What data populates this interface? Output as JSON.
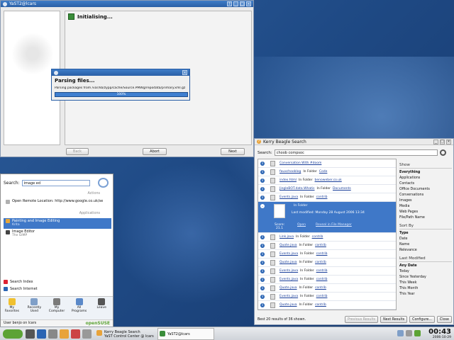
{
  "yast": {
    "title": "YaST2@lcars",
    "heading": "Initialising...",
    "buttons": {
      "back": "Back",
      "abort": "Abort",
      "next": "Next"
    }
  },
  "parsing": {
    "title": "",
    "heading": "Parsing files...",
    "detail": "Parsing packages from /var/lib/zypp/cache/Source.PMWg/repodata/primary.xml.gz",
    "progress_label": "100%",
    "progress": 100
  },
  "beagle": {
    "title": "Kerry Beagle Search",
    "search_label": "Search:",
    "search_value": "choob compsoc",
    "results": [
      {
        "name": "Conversation With #doom",
        "mid": "",
        "folder": ""
      },
      {
        "name": "fauxchooblog",
        "mid": "In Folder",
        "folder": "Code"
      },
      {
        "name": "index.html",
        "mid": "In Folder",
        "folder": "benoweber.co.uk"
      },
      {
        "name": "JingleBOT.data.Whatis",
        "mid": "In Folder",
        "folder": "Documents"
      },
      {
        "name": "Events.java",
        "mid": "In Folder",
        "folder": "contrib"
      }
    ],
    "selected": {
      "name": "",
      "mid": "In Folder",
      "folder": "",
      "modified": "Last modified: Monday 28 August 2006 13:34",
      "score_label": "Score:",
      "score": "21.1",
      "action_open": "Open",
      "action_reveal": "Reveal in File Manager"
    },
    "results_after": [
      {
        "name": "Link.java",
        "mid": "In Folder",
        "folder": "contrib"
      },
      {
        "name": "Quote.java",
        "mid": "In Folder",
        "folder": "contrib"
      },
      {
        "name": "Events.java",
        "mid": "In Folder",
        "folder": "contrib"
      },
      {
        "name": "Quote.java",
        "mid": "In Folder",
        "folder": "contrib"
      },
      {
        "name": "Events.java",
        "mid": "In Folder",
        "folder": "contrib"
      },
      {
        "name": "Events.java",
        "mid": "In Folder",
        "folder": "contrib"
      },
      {
        "name": "Quote.java",
        "mid": "In Folder",
        "folder": "contrib"
      },
      {
        "name": "Events.java",
        "mid": "In Folder",
        "folder": "contrib"
      },
      {
        "name": "Quote.java",
        "mid": "In Folder",
        "folder": "contrib"
      }
    ],
    "sidebar": {
      "show_heading": "Show",
      "show": [
        "Everything",
        "Applications",
        "Contacts",
        "Office Documents",
        "Conversations",
        "Images",
        "Media",
        "Web Pages",
        "File/Path Name"
      ],
      "sort_heading": "Sort By",
      "sort": [
        "Type",
        "Date",
        "Name",
        "Relevance"
      ],
      "last_heading": "Last Modified",
      "last": [
        "Any Date",
        "Today",
        "Since Yesterday",
        "This Week",
        "This Month",
        "This Year"
      ]
    },
    "footer": {
      "status": "Best 20 results of 36 shown.",
      "prev": "Previous Results",
      "next": "Next Results",
      "configure": "Configure...",
      "close": "Close"
    }
  },
  "menu": {
    "search_label": "Search:",
    "search_value": "image ed",
    "section_actions": "Actions",
    "action_item": "Open Remote Location: http://www.google.co.uk/se",
    "section_apps": "Applications",
    "app1": {
      "title": "Painting and Image Editing",
      "sub": "Krita"
    },
    "app2": {
      "title": "Image Editor",
      "sub": "The GIMP"
    },
    "search_index": "Search Index",
    "search_internet": "Search Internet",
    "tabs": [
      {
        "label": "My\nFavorites"
      },
      {
        "label": "Recently\nUsed"
      },
      {
        "label": "My\nComputer"
      },
      {
        "label": "All\nPrograms"
      },
      {
        "label": "Leave"
      }
    ],
    "user": "User benjo on lcars",
    "brand": "openSUSE"
  },
  "taskbar": {
    "tasks": [
      {
        "label": "Kerry Beagle Search",
        "label2": "YaST Control Center @ lcars"
      },
      {
        "label": "YaST2@lcars",
        "label2": ""
      }
    ],
    "time": "00:43",
    "date": "2006-10-29"
  },
  "colors": {
    "accent": "#3f78c8",
    "titlebar": "#2a5fa6",
    "brand": "#5ca335"
  }
}
